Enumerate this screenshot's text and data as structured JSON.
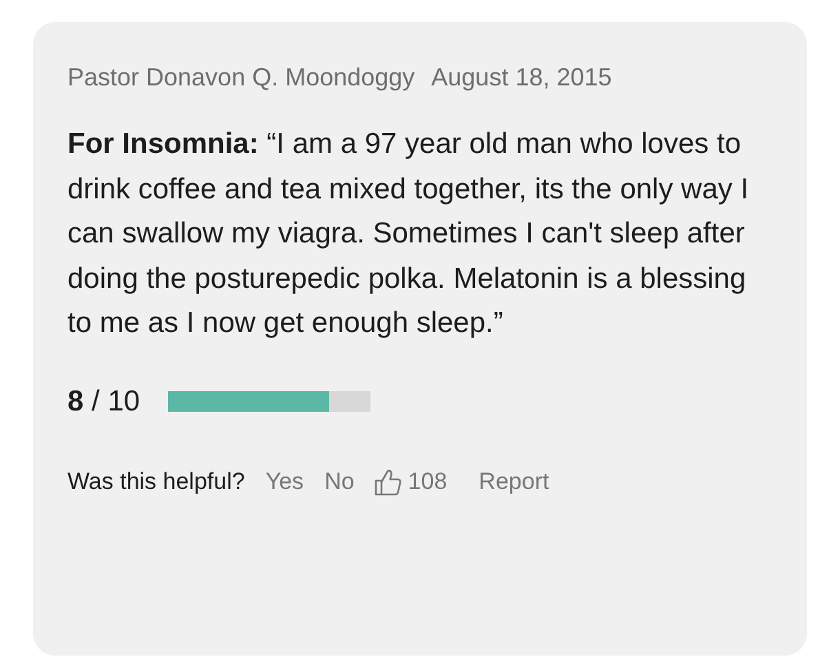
{
  "review": {
    "author": "Pastor Donavon Q. Moondoggy",
    "date": "August 18, 2015",
    "text": "**For Insomnia:** “I am a 97 year old man who loves to drink coffee and tea mixed together, its the only way I can swallow my viagra. Sometimes I can't sleep after doing the posturepedic polka. Melatonin is a blessing to me as I now get enough sleep.”",
    "rating": "**8** / 10",
    "level": 0.8,
    "helpful_prompt": "Was this helpful?",
    "yes": "Yes",
    "no": "No",
    "likes": "108",
    "report": "Report"
  }
}
